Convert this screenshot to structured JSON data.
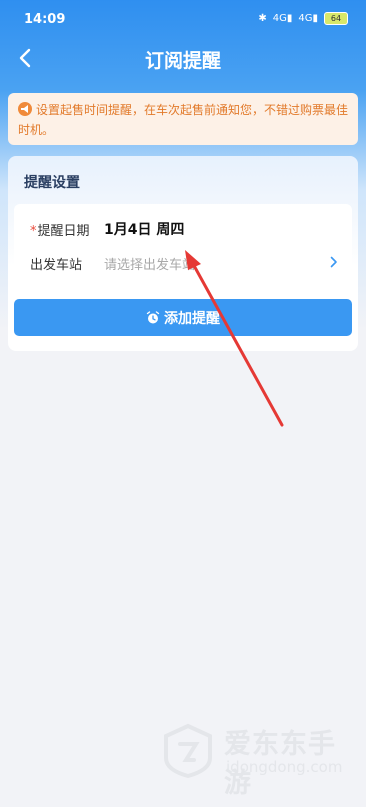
{
  "status_bar": {
    "time": "14:09",
    "signal1": "4G",
    "signal2": "4G",
    "battery": "64"
  },
  "header": {
    "title": "订阅提醒"
  },
  "notice": {
    "text": "设置起售时间提醒，在车次起售前通知您，不错过购票最佳时机。"
  },
  "settings_card": {
    "title": "提醒设置",
    "date_row": {
      "required_mark": "*",
      "label": "提醒日期",
      "value": "1月4日 周四"
    },
    "station_row": {
      "label": "出发车站",
      "placeholder": "请选择出发车站"
    },
    "add_button_label": "添加提醒"
  },
  "watermark": {
    "brand_cn": "爱东东手游",
    "brand_en": "idongdong.com"
  },
  "colors": {
    "accent": "#3a98f2",
    "notice_text": "#e27a2b",
    "annotation_arrow": "#e53935"
  },
  "icons": {
    "back": "back-arrow-icon",
    "notice": "megaphone-icon",
    "button": "alarm-clock-icon",
    "station_row": "chevron-right-icon"
  }
}
